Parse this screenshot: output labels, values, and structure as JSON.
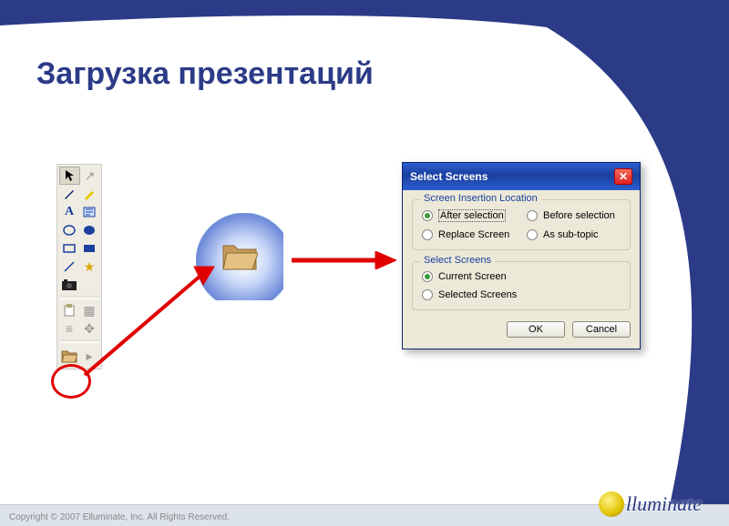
{
  "title": "Загрузка презентаций",
  "dialog": {
    "title": "Select Screens",
    "group1": {
      "legend": "Screen Insertion Location",
      "options": {
        "after": "After selection",
        "before": "Before selection",
        "replace": "Replace Screen",
        "subtopic": "As sub-topic"
      },
      "selected": "after"
    },
    "group2": {
      "legend": "Select Screens",
      "options": {
        "current": "Current Screen",
        "selected": "Selected Screens"
      },
      "selected": "current"
    },
    "buttons": {
      "ok": "OK",
      "cancel": "Cancel"
    }
  },
  "logo_text": "lluminate",
  "copyright": "Copyright © 2007 Elluminate, Inc. All Rights Reserved."
}
